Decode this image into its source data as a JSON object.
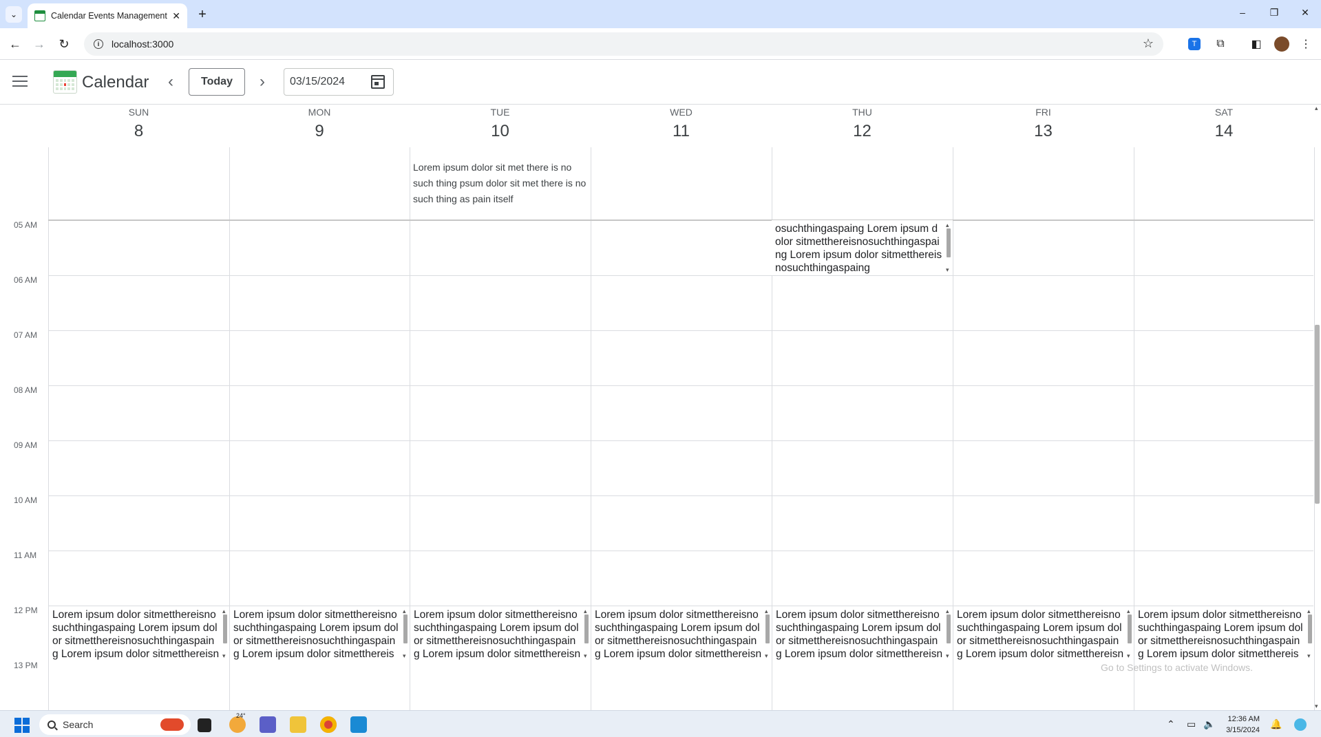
{
  "browser": {
    "tab_title": "Calendar Events Management",
    "tab_close": "✕",
    "new_tab": "+",
    "url": "localhost:3000",
    "window_controls": [
      "–",
      "❐",
      "✕"
    ]
  },
  "app": {
    "title": "Calendar",
    "today_label": "Today",
    "prev_label": "‹",
    "next_label": "›",
    "date_value": "03/15/2024"
  },
  "days": [
    {
      "dow": "SUN",
      "num": "8"
    },
    {
      "dow": "MON",
      "num": "9"
    },
    {
      "dow": "TUE",
      "num": "10"
    },
    {
      "dow": "WED",
      "num": "11"
    },
    {
      "dow": "THU",
      "num": "12"
    },
    {
      "dow": "FRI",
      "num": "13"
    },
    {
      "dow": "SAT",
      "num": "14"
    }
  ],
  "hours": [
    "05 AM",
    "06 AM",
    "07 AM",
    "08 AM",
    "09 AM",
    "10 AM",
    "11 AM",
    "12 PM",
    "13 PM"
  ],
  "events": {
    "allday_tue": "Lorem ipsum dolor sit met there is no such thing psum dolor sit met there is no such thing as pain itself",
    "thu_5am": "osuchthingaspaing Lorem ipsum dolor sitmetthereisnosuchthingaspaing Lorem ipsum dolor sitmetthereisnosuchthingaspaing",
    "noon_text": "Lorem ipsum dolor sitmetthereisnosuchthingaspaing Lorem ipsum dolor sitmetthereisnosuchthingaspaing Lorem ipsum dolor sitmetthereisnosuchthingaspaing"
  },
  "watermark": "Go to Settings to activate Windows.",
  "taskbar": {
    "search_placeholder": "Search",
    "weather": "24°",
    "time": "12:36 AM",
    "date": "3/15/2024"
  }
}
